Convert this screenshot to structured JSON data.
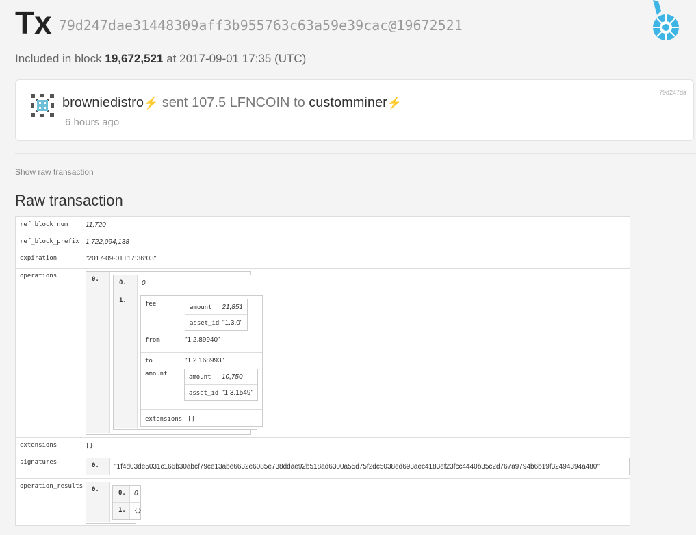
{
  "header": {
    "tx_label": "Tx",
    "tx_hash": "79d247dae31448309aff3b955763c63a59e39cac@19672521",
    "block_prefix": "Included in block",
    "block_number": "19,672,521",
    "block_at": "at",
    "block_time": "2017-09-01 17:35 (UTC)"
  },
  "operation": {
    "from": "browniedistro",
    "verb": "sent",
    "amount": "107.5 LFNCOIN",
    "to_word": "to",
    "to": "customminer",
    "time_ago": "6 hours ago",
    "id": "79d247da"
  },
  "show_raw_label": "Show raw transaction",
  "raw_title": "Raw transaction",
  "raw": {
    "ref_block_num_key": "ref_block_num",
    "ref_block_num": "11,720",
    "ref_block_prefix_key": "ref_block_prefix",
    "ref_block_prefix": "1,722,094,138",
    "expiration_key": "expiration",
    "expiration": "\"2017-09-01T17:36:03\"",
    "operations_key": "operations",
    "op_index": "0.",
    "op_type_index": "0.",
    "op_type": "0",
    "op_body_index": "1.",
    "fee_key": "fee",
    "fee_amount_key": "amount",
    "fee_amount": "21,851",
    "fee_asset_key": "asset_id",
    "fee_asset": "\"1.3.0\"",
    "from_key": "from",
    "from": "\"1.2.89940\"",
    "to_key": "to",
    "to": "\"1.2.168993\"",
    "amount_key": "amount",
    "amt_amount_key": "amount",
    "amt_amount": "10,750",
    "amt_asset_key": "asset_id",
    "amt_asset": "\"1.3.1549\"",
    "op_ext_key": "extensions",
    "op_ext": "[]",
    "extensions_key": "extensions",
    "extensions": "[]",
    "signatures_key": "signatures",
    "sig_index": "0.",
    "signature": "\"1f4d03de5031c166b30abcf79ce13abe6632e6085e738ddae92b518ad6300a55d75f2dc5038ed693aec4183ef23fcc4440b35c2d767a9794b6b19f32494394a480\"",
    "operation_results_key": "operation_results",
    "res_index": "0.",
    "res0_index": "0.",
    "res0": "0",
    "res1_index": "1.",
    "res1": "{}"
  },
  "colors": {
    "accent": "#2a8dd4",
    "logo": "#3fb5e5"
  }
}
